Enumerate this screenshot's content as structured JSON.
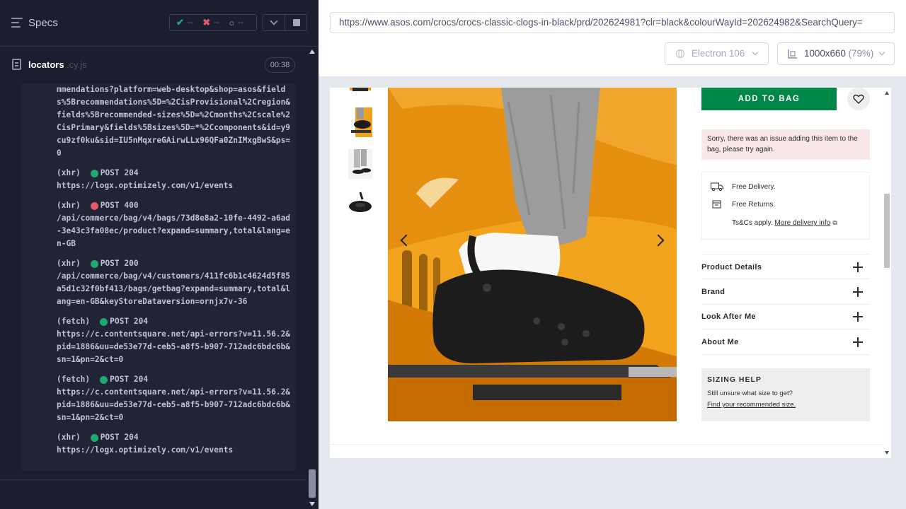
{
  "reporter": {
    "header": {
      "specs_label": "Specs",
      "passed": "--",
      "failed": "--",
      "pending": "--"
    },
    "spec_file": {
      "name": "locators",
      "extension": ".cy.js",
      "duration": "00:38"
    },
    "log": [
      {
        "kind": "",
        "method": "",
        "status": "",
        "status_color": "",
        "url": "mmendations?platform=web-desktop&shop=asos&fields%5Brecommendations%5D=%2CisProvisional%2Cregion&fields%5Brecommended-sizes%5D=%2Cmonths%2Cscale%2CisPrimary&fields%5Bsizes%5D=*%2Ccomponents&id=y9cu9zf0ku&sid=IU5nMqxreGAirwLLx96QFa0ZnIMxgBwS&ps=0"
      },
      {
        "kind": "(xhr)",
        "method": "POST",
        "status": "204",
        "status_color": "green",
        "url": "https://logx.optimizely.com/v1/events"
      },
      {
        "kind": "(xhr)",
        "method": "POST",
        "status": "400",
        "status_color": "red",
        "url": "/api/commerce/bag/v4/bags/73d8e8a2-10fe-4492-a6ad-3e43c3fa08ec/product?expand=summary,total&lang=en-GB"
      },
      {
        "kind": "(xhr)",
        "method": "POST",
        "status": "200",
        "status_color": "green",
        "url": "/api/commerce/bag/v4/customers/411fc6b1c4624d5f85a5d1c32f0bf413/bags/getbag?expand=summary,total&lang=en-GB&keyStoreDataversion=ornjx7v-36"
      },
      {
        "kind": "(fetch)",
        "method": "POST",
        "status": "204",
        "status_color": "green",
        "url": "https://c.contentsquare.net/api-errors?v=11.56.2&pid=1886&uu=de53e77d-ceb5-a8f5-b907-712adc6bdc6b&sn=1&pn=2&ct=0"
      },
      {
        "kind": "(fetch)",
        "method": "POST",
        "status": "204",
        "status_color": "green",
        "url": "https://c.contentsquare.net/api-errors?v=11.56.2&pid=1886&uu=de53e77d-ceb5-a8f5-b907-712adc6bdc6b&sn=1&pn=2&ct=0"
      },
      {
        "kind": "(xhr)",
        "method": "POST",
        "status": "204",
        "status_color": "green",
        "url": "https://logx.optimizely.com/v1/events"
      }
    ]
  },
  "aut": {
    "url": "https://www.asos.com/crocs/crocs-classic-clogs-in-black/prd/202624981?clr=black&colourWayId=202624982&SearchQuery=",
    "browser": "Electron 106",
    "viewport": "1000x660",
    "scale": "(79%)"
  },
  "product_page": {
    "add_to_bag": "ADD TO BAG",
    "error_message": "Sorry, there was an issue adding this item to the bag, please try again.",
    "delivery": {
      "free_delivery": "Free Delivery.",
      "free_returns": "Free Returns.",
      "terms": "Ts&Cs apply.",
      "more_info": "More delivery info"
    },
    "accordions": [
      "Product Details",
      "Brand",
      "Look After Me",
      "About Me"
    ],
    "sizing": {
      "title": "SIZING HELP",
      "description": "Still unsure what size to get?",
      "link": "Find your recommended size."
    }
  },
  "colors": {
    "reporter_bg": "#1b1e2e",
    "pass": "#1fa971",
    "fail": "#e45770",
    "asos_green": "#018849"
  }
}
